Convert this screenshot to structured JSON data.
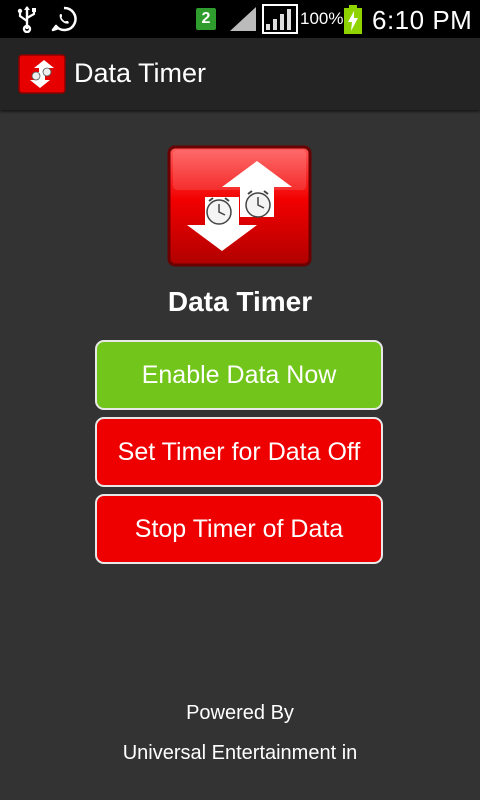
{
  "status_bar": {
    "sim_badge": "2",
    "battery_percent": "100%",
    "time": "6:10 PM",
    "icons": [
      "usb-icon",
      "whatsapp-icon",
      "signal-icon",
      "battery-charging-icon"
    ]
  },
  "action_bar": {
    "title": "Data Timer",
    "icon": "data-timer-app-icon"
  },
  "main": {
    "title": "Data Timer",
    "logo_icon": "data-timer-logo-icon",
    "buttons": {
      "enable": "Enable Data Now",
      "set_timer": "Set Timer for Data Off",
      "stop_timer": "Stop Timer of Data"
    }
  },
  "footer": {
    "line1": "Powered By",
    "line2": "Universal Entertainment in"
  },
  "colors": {
    "background": "#333333",
    "status_bar": "#000000",
    "action_bar": "#242424",
    "enable_button": "#72c51a",
    "timer_buttons": "#ee0000"
  }
}
